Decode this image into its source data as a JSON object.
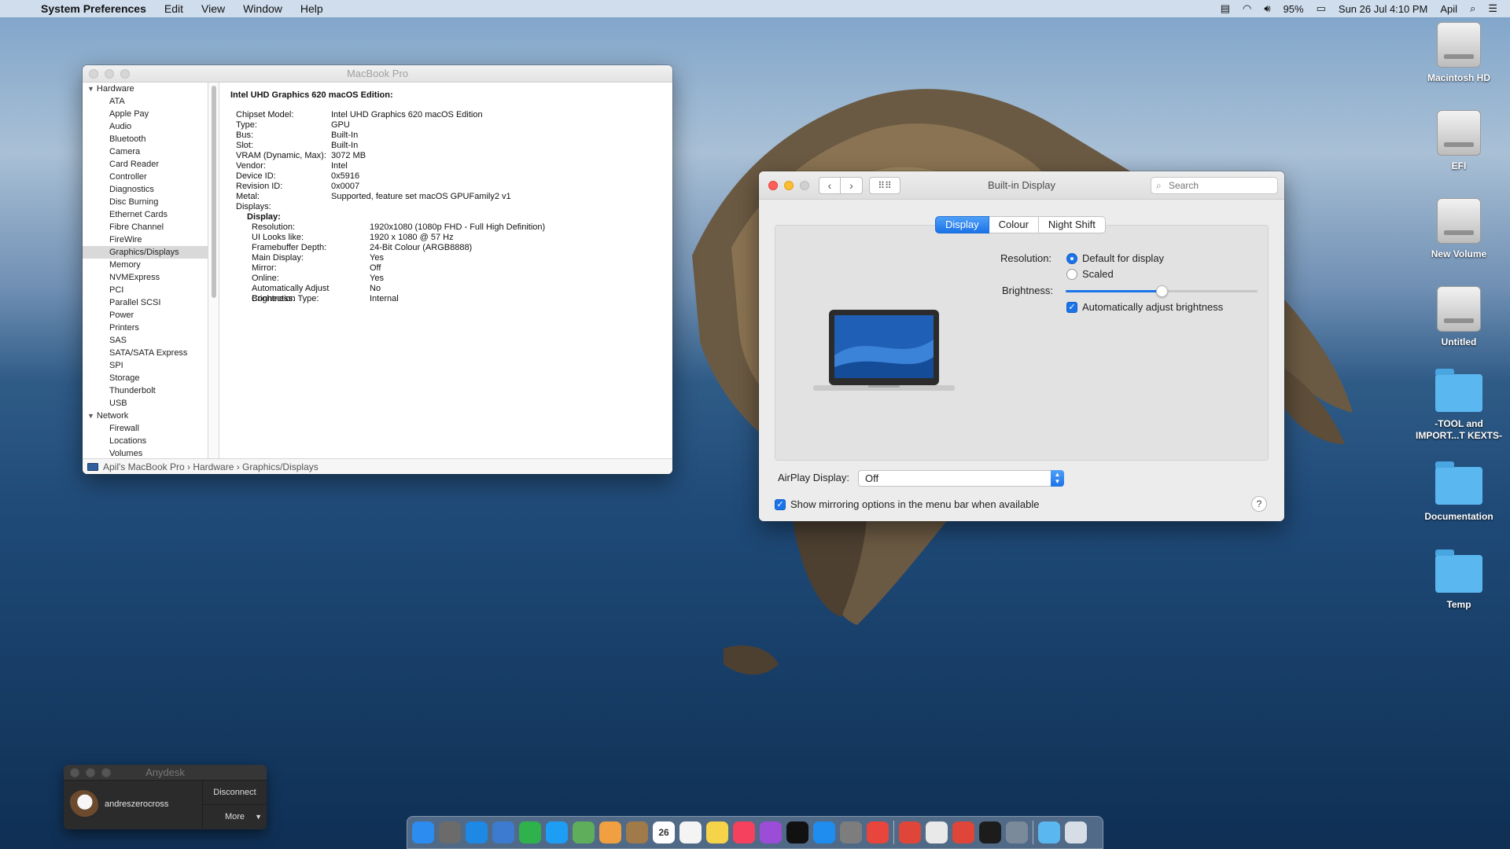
{
  "menubar": {
    "app_name": "System Preferences",
    "menus": [
      "Edit",
      "View",
      "Window",
      "Help"
    ],
    "battery": "95%",
    "datetime": "Sun 26 Jul  4:10 PM",
    "user": "Apil"
  },
  "sysinfo": {
    "title": "MacBook Pro",
    "sidebar": {
      "hardware_label": "Hardware",
      "hardware_items": [
        "ATA",
        "Apple Pay",
        "Audio",
        "Bluetooth",
        "Camera",
        "Card Reader",
        "Controller",
        "Diagnostics",
        "Disc Burning",
        "Ethernet Cards",
        "Fibre Channel",
        "FireWire",
        "Graphics/Displays",
        "Memory",
        "NVMExpress",
        "PCI",
        "Parallel SCSI",
        "Power",
        "Printers",
        "SAS",
        "SATA/SATA Express",
        "SPI",
        "Storage",
        "Thunderbolt",
        "USB"
      ],
      "selected": "Graphics/Displays",
      "network_label": "Network",
      "network_items": [
        "Firewall",
        "Locations",
        "Volumes"
      ]
    },
    "content": {
      "heading": "Intel UHD Graphics 620 macOS Edition:",
      "fields": [
        {
          "k": "Chipset Model:",
          "v": "Intel UHD Graphics 620 macOS Edition"
        },
        {
          "k": "Type:",
          "v": "GPU"
        },
        {
          "k": "Bus:",
          "v": "Built-In"
        },
        {
          "k": "Slot:",
          "v": "Built-In"
        },
        {
          "k": "VRAM (Dynamic, Max):",
          "v": "3072 MB"
        },
        {
          "k": "Vendor:",
          "v": "Intel"
        },
        {
          "k": "Device ID:",
          "v": "0x5916"
        },
        {
          "k": "Revision ID:",
          "v": "0x0007"
        },
        {
          "k": "Metal:",
          "v": "Supported, feature set macOS GPUFamily2 v1"
        },
        {
          "k": "Displays:",
          "v": ""
        }
      ],
      "display_label": "Display:",
      "display_fields": [
        {
          "k": "Resolution:",
          "v": "1920x1080 (1080p FHD - Full High Definition)"
        },
        {
          "k": "UI Looks like:",
          "v": "1920 x 1080 @ 57 Hz"
        },
        {
          "k": "Framebuffer Depth:",
          "v": "24-Bit Colour (ARGB8888)"
        },
        {
          "k": "Main Display:",
          "v": "Yes"
        },
        {
          "k": "Mirror:",
          "v": "Off"
        },
        {
          "k": "Online:",
          "v": "Yes"
        },
        {
          "k": "Automatically Adjust Brightness:",
          "v": "No"
        },
        {
          "k": "Connection Type:",
          "v": "Internal"
        }
      ]
    },
    "path": [
      "Apil's MacBook Pro",
      "Hardware",
      "Graphics/Displays"
    ]
  },
  "display_prefs": {
    "title": "Built-in Display",
    "search_placeholder": "Search",
    "tabs": [
      "Display",
      "Colour",
      "Night Shift"
    ],
    "active_tab": "Display",
    "resolution_label": "Resolution:",
    "resolution_options": [
      "Default for display",
      "Scaled"
    ],
    "resolution_selected": "Default for display",
    "brightness_label": "Brightness:",
    "brightness_level": 0.5,
    "auto_brightness_label": "Automatically adjust brightness",
    "auto_brightness_checked": true,
    "airplay_label": "AirPlay Display:",
    "airplay_value": "Off",
    "mirroring_label": "Show mirroring options in the menu bar when available",
    "mirroring_checked": true,
    "help_label": "?"
  },
  "desktop_icons": [
    {
      "label": "Macintosh HD",
      "type": "disk"
    },
    {
      "label": "EFI",
      "type": "disk"
    },
    {
      "label": "New Volume",
      "type": "disk"
    },
    {
      "label": "Untitled",
      "type": "disk"
    },
    {
      "label": "-TOOL and IMPORT...T KEXTS-",
      "type": "folder"
    },
    {
      "label": "Documentation",
      "type": "folder"
    },
    {
      "label": "Temp",
      "type": "folder"
    }
  ],
  "anydesk": {
    "title": "Anydesk",
    "user": "andreszerocross",
    "disconnect": "Disconnect",
    "more": "More"
  },
  "dock": {
    "calendar_day": "26",
    "apps": [
      {
        "name": "finder",
        "color": "#2d8cf0"
      },
      {
        "name": "launchpad",
        "color": "#6b6b6b"
      },
      {
        "name": "safari",
        "color": "#1e88e5"
      },
      {
        "name": "preview",
        "color": "#3c7bd0"
      },
      {
        "name": "facetime",
        "color": "#2fb24c"
      },
      {
        "name": "messages",
        "color": "#1e9df5"
      },
      {
        "name": "maps",
        "color": "#5fae5b"
      },
      {
        "name": "photos",
        "color": "#f0a040"
      },
      {
        "name": "notebook",
        "color": "#a07a48"
      },
      {
        "name": "calendar",
        "color": "#ffffff"
      },
      {
        "name": "reminders",
        "color": "#f4f4f4"
      },
      {
        "name": "notes",
        "color": "#f6d44a"
      },
      {
        "name": "music",
        "color": "#f5405e"
      },
      {
        "name": "podcasts",
        "color": "#9b4dd8"
      },
      {
        "name": "tv",
        "color": "#111111"
      },
      {
        "name": "app-store",
        "color": "#1f8cf0"
      },
      {
        "name": "system-preferences",
        "color": "#7d7d7d"
      },
      {
        "name": "chrome",
        "color": "#e8453c"
      },
      {
        "name": "anydesk",
        "color": "#e0453a"
      },
      {
        "name": "textedit",
        "color": "#e9e9e9"
      },
      {
        "name": "remote-tool",
        "color": "#e0453a"
      },
      {
        "name": "terminal",
        "color": "#1c1c1c"
      },
      {
        "name": "xcode-tool",
        "color": "#7a8a9a"
      },
      {
        "name": "downloads-folder",
        "color": "#5bb7ef"
      },
      {
        "name": "trash",
        "color": "#d6dde6"
      }
    ]
  }
}
